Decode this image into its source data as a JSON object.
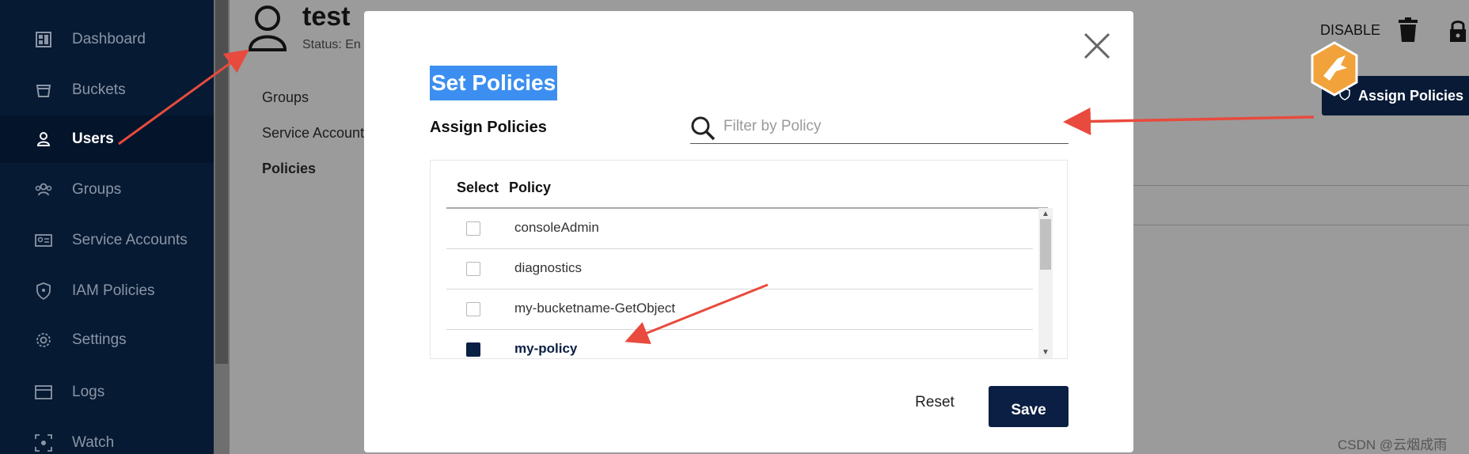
{
  "sidebar": {
    "items": [
      {
        "label": "Dashboard",
        "icon": "dashboard-icon",
        "active": false
      },
      {
        "label": "Buckets",
        "icon": "bucket-icon",
        "active": false
      },
      {
        "label": "Users",
        "icon": "user-icon",
        "active": true
      },
      {
        "label": "Groups",
        "icon": "groups-icon",
        "active": false
      },
      {
        "label": "Service Accounts",
        "icon": "service-accounts-icon",
        "active": false
      },
      {
        "label": "IAM Policies",
        "icon": "shield-icon",
        "active": false
      },
      {
        "label": "Settings",
        "icon": "gear-icon",
        "active": false
      },
      {
        "label": "Logs",
        "icon": "logs-icon",
        "active": false
      },
      {
        "label": "Watch",
        "icon": "watch-icon",
        "active": false
      }
    ]
  },
  "user": {
    "name": "test",
    "status": "Status: En"
  },
  "subnav": {
    "groups": "Groups",
    "service_accounts": "Service Accounts",
    "policies": "Policies"
  },
  "actions": {
    "disable": "DISABLE",
    "assign_policies": "Assign Policies"
  },
  "modal": {
    "title": "Set Policies",
    "assign_label": "Assign Policies",
    "search_placeholder": "Filter by Policy",
    "columns": {
      "select": "Select",
      "policy": "Policy"
    },
    "rows": [
      {
        "policy": "consoleAdmin",
        "checked": false
      },
      {
        "policy": "diagnostics",
        "checked": false
      },
      {
        "policy": "my-bucketname-GetObject",
        "checked": false
      },
      {
        "policy": "my-policy",
        "checked": true
      }
    ],
    "reset_label": "Reset",
    "save_label": "Save"
  },
  "watermark": "CSDN @云烟成雨",
  "colors": {
    "sidebar_bg": "#061a33",
    "accent_navy": "#0b1f44",
    "selection_blue": "#3c8ff0",
    "annotation_red": "#e84a3d"
  }
}
